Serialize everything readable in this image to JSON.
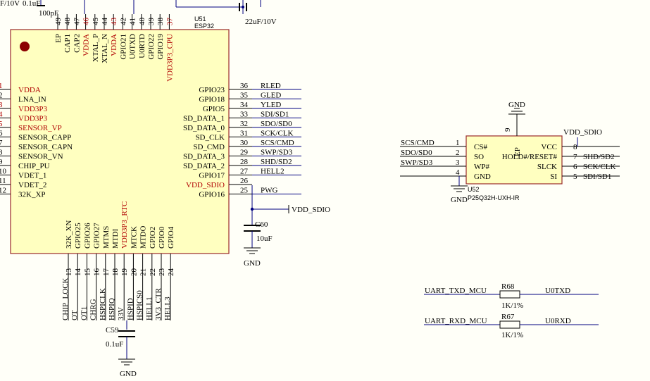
{
  "colors": {
    "background": "#fffff8",
    "chip_fill": "#ffffc0",
    "chip_stroke": "#9a2a2a",
    "wire": "#000080",
    "pin": "#000000",
    "power_pin_text": "#b00000",
    "dot": "#8b0000"
  },
  "u51": {
    "designator": "U51",
    "part": "ESP32",
    "left_pins": [
      {
        "num": "1",
        "name": "VDDA",
        "power": true
      },
      {
        "num": "2",
        "name": "LNA_IN",
        "power": false
      },
      {
        "num": "3",
        "name": "VDD3P3",
        "power": true
      },
      {
        "num": "4",
        "name": "VDD3P3",
        "power": true
      },
      {
        "num": "5",
        "name": "SENSOR_VP",
        "power": true
      },
      {
        "num": "6",
        "name": "SENSOR_CAPP",
        "power": false
      },
      {
        "num": "7",
        "name": "SENSOR_CAPN",
        "power": false
      },
      {
        "num": "8",
        "name": "SENSOR_VN",
        "power": false
      },
      {
        "num": "9",
        "name": "CHIP_PU",
        "power": false
      },
      {
        "num": "10",
        "name": "VDET_1",
        "power": false
      },
      {
        "num": "11",
        "name": "VDET_2",
        "power": false
      },
      {
        "num": "12",
        "name": "32K_XP",
        "power": false
      }
    ],
    "right_pins": [
      {
        "num": "36",
        "name": "GPIO23",
        "net": "RLED",
        "power": false
      },
      {
        "num": "35",
        "name": "GPIO18",
        "net": "GLED",
        "power": false
      },
      {
        "num": "34",
        "name": "GPIO5",
        "net": "YLED",
        "power": false
      },
      {
        "num": "33",
        "name": "SD_DATA_1",
        "net": "SDI/SD1",
        "power": false
      },
      {
        "num": "32",
        "name": "SD_DATA_0",
        "net": "SDO/SD0",
        "power": false
      },
      {
        "num": "31",
        "name": "SD_CLK",
        "net": "SCK/CLK",
        "power": false
      },
      {
        "num": "30",
        "name": "SD_CMD",
        "net": "SCS/CMD",
        "power": false
      },
      {
        "num": "29",
        "name": "SD_DATA_3",
        "net": "SWP/SD3",
        "power": false
      },
      {
        "num": "28",
        "name": "SD_DATA_2",
        "net": "SHD/SD2",
        "power": false
      },
      {
        "num": "27",
        "name": "GPIO17",
        "net": "HELL2",
        "power": false
      },
      {
        "num": "26",
        "name": "VDD_SDIO",
        "net": "",
        "power": true
      },
      {
        "num": "25",
        "name": "GPIO16",
        "net": "PWG",
        "power": false
      }
    ],
    "top_pins": [
      {
        "num": "49",
        "name": "EP",
        "power": false
      },
      {
        "num": "48",
        "name": "CAP1",
        "power": false
      },
      {
        "num": "47",
        "name": "CAP2",
        "power": false
      },
      {
        "num": "46",
        "name": "VDDA",
        "power": true
      },
      {
        "num": "45",
        "name": "XTAL_P",
        "power": false
      },
      {
        "num": "44",
        "name": "XTAL_N",
        "power": false
      },
      {
        "num": "43",
        "name": "VDDA",
        "power": true
      },
      {
        "num": "42",
        "name": "GPIO21",
        "power": false
      },
      {
        "num": "41",
        "name": "U0TXD",
        "power": false
      },
      {
        "num": "40",
        "name": "U0RTD",
        "power": false
      },
      {
        "num": "39",
        "name": "GPIO22",
        "power": false
      },
      {
        "num": "38",
        "name": "GPIO19",
        "power": false
      },
      {
        "num": "37",
        "name": "VDD3P3_CPU",
        "power": true
      }
    ],
    "bottom_pins": [
      {
        "num": "13",
        "name": "32K_XN",
        "net": "CHIP_LOCK",
        "power": false
      },
      {
        "num": "14",
        "name": "GPIO25",
        "net": "OT",
        "power": false
      },
      {
        "num": "15",
        "name": "GPIO26",
        "net": "OT1",
        "power": false
      },
      {
        "num": "16",
        "name": "GPIO27",
        "net": "CHRG",
        "power": false
      },
      {
        "num": "17",
        "name": "MTMS",
        "net": "HSPICLK",
        "power": false
      },
      {
        "num": "18",
        "name": "MTDI",
        "net": "HSPIQ",
        "power": false
      },
      {
        "num": "19",
        "name": "VDD3P3_RTC",
        "net": "33V",
        "power": true
      },
      {
        "num": "20",
        "name": "MTCK",
        "net": "HSPID",
        "power": false
      },
      {
        "num": "21",
        "name": "MTDO",
        "net": "HSPICS0",
        "power": false
      },
      {
        "num": "22",
        "name": "GPIO2",
        "net": "HELL1",
        "power": false
      },
      {
        "num": "23",
        "name": "GPIO0",
        "net": "3V3_CTR",
        "power": false
      },
      {
        "num": "24",
        "name": "GPIO4",
        "net": "HELL3",
        "power": false
      }
    ]
  },
  "top_fragments": {
    "cap_left": "F/10V",
    "cap_left2": "0.1uF",
    "cap_100pf": "100pF",
    "cap_22uf": "22uF/10V"
  },
  "c60": {
    "designator": "C60",
    "value": "10uF",
    "ground": "GND",
    "net_flag": "VDD_SDIO"
  },
  "c59": {
    "designator": "C59",
    "value": "0.1uF",
    "ground": "GND"
  },
  "u52": {
    "designator": "U52",
    "part": "P25Q32H-UXH-IR",
    "ground_top": "GND",
    "ground_bottom": "GND",
    "supply_net": "VDD_SDIO",
    "left_pins": [
      {
        "num": "1",
        "name": "CS#",
        "net": "SCS/CMD"
      },
      {
        "num": "2",
        "name": "SO",
        "net": "SDO/SD0"
      },
      {
        "num": "3",
        "name": "WP#",
        "net": "SWP/SD3"
      },
      {
        "num": "4",
        "name": "GND",
        "net": ""
      }
    ],
    "right_pins": [
      {
        "num": "8",
        "name": "VCC",
        "net": ""
      },
      {
        "num": "7",
        "name": "HOLD#/RESET#",
        "net": "SHD/SD2"
      },
      {
        "num": "6",
        "name": "SLCK",
        "net": "SCK/CLK"
      },
      {
        "num": "5",
        "name": "SI",
        "net": "SDI/SD1"
      }
    ],
    "top_pin": {
      "num": "9",
      "name": "EP"
    }
  },
  "r68": {
    "designator": "R68",
    "value": "1K/1%",
    "net_left": "UART_TXD_MCU",
    "net_right": "U0TXD"
  },
  "r67": {
    "designator": "R67",
    "value": "1K/1%",
    "net_left": "UART_RXD_MCU",
    "net_right": "U0RXD"
  }
}
